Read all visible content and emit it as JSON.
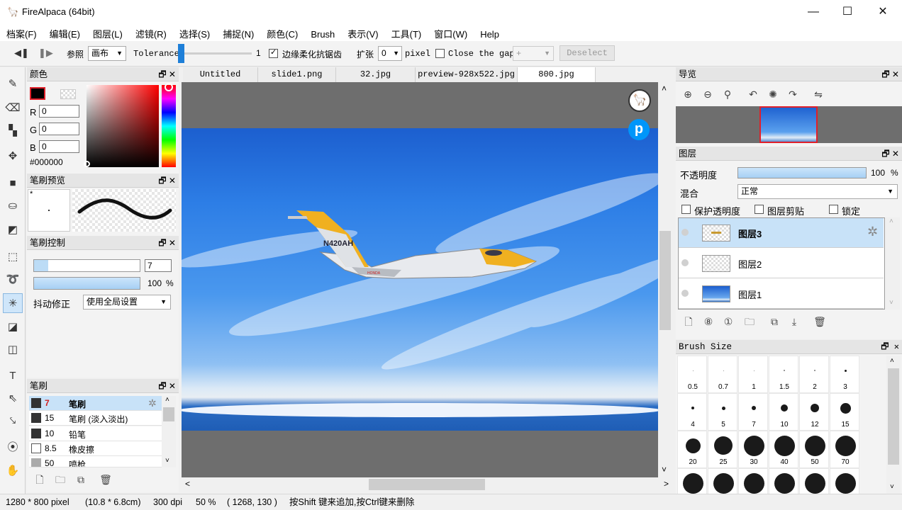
{
  "window": {
    "title": "FireAlpaca (64bit)",
    "minimize": "—",
    "maximize": "☐",
    "close": "✕"
  },
  "menu": [
    "档案(F)",
    "编辑(E)",
    "图层(L)",
    "滤镜(R)",
    "选择(S)",
    "捕捉(N)",
    "颜色(C)",
    "Brush",
    "表示(V)",
    "工具(T)",
    "窗口(W)",
    "Help"
  ],
  "toolbar": {
    "reference_label": "参照",
    "reference_value": "画布",
    "tolerance_label": "Tolerance",
    "tolerance_value": "1",
    "antialias_label": "边缘柔化抗锯齿",
    "antialias_checked": true,
    "expand_label": "扩张",
    "expand_value": "0",
    "expand_unit": "pixel",
    "close_gap_label": "Close the gap",
    "close_gap_value": "+",
    "deselect_label": "Deselect"
  },
  "color_panel": {
    "title": "颜色",
    "r_label": "R",
    "g_label": "G",
    "b_label": "B",
    "r": "0",
    "g": "0",
    "b": "0",
    "hex": "#000000",
    "fg": "#000000"
  },
  "brush_preview": {
    "title": "笔刷预览",
    "tiny_mark": "*"
  },
  "brush_control": {
    "title": "笔刷控制",
    "size": "7",
    "opacity": "100",
    "percent": "%",
    "stabilizer_label": "抖动修正",
    "stabilizer_value": "使用全局设置"
  },
  "brush_panel": {
    "title": "笔刷",
    "items": [
      {
        "size": "7",
        "name": "笔刷",
        "color": "#333333",
        "active": true
      },
      {
        "size": "15",
        "name": "笔刷 (淡入淡出)",
        "color": "#333333",
        "active": false
      },
      {
        "size": "10",
        "name": "铅笔",
        "color": "#333333",
        "active": false
      },
      {
        "size": "8.5",
        "name": "橡皮擦",
        "color": "#ffffff",
        "active": false
      },
      {
        "size": "50",
        "name": "喷枪",
        "color": "#333333",
        "active": false
      }
    ]
  },
  "tabs": [
    {
      "label": "Untitled",
      "active": false
    },
    {
      "label": "slide1.png",
      "active": false
    },
    {
      "label": "32.jpg",
      "active": false
    },
    {
      "label": "preview-928x522.jpg",
      "active": false
    },
    {
      "label": "800.jpg",
      "active": true
    }
  ],
  "canvas": {
    "plane_text": "N420AH",
    "brand_text": "HONDA",
    "scroll_up": "˄",
    "scroll_down": "˅",
    "scroll_left": "<",
    "scroll_right": ">"
  },
  "navigator": {
    "title": "导览"
  },
  "layers": {
    "title": "图层",
    "opacity_label": "不透明度",
    "opacity_value": "100",
    "percent": "%",
    "blend_label": "混合",
    "blend_value": "正常",
    "protect_label": "保护透明度",
    "clip_label": "图层剪贴",
    "lock_label": "锁定",
    "items": [
      {
        "name": "图层3",
        "active": true
      },
      {
        "name": "图层2",
        "active": false
      },
      {
        "name": "图层1",
        "active": false
      }
    ]
  },
  "brush_size": {
    "title": "Brush Size",
    "sizes": [
      "0.5",
      "0.7",
      "1",
      "1.5",
      "2",
      "3",
      "4",
      "5",
      "7",
      "10",
      "12",
      "15",
      "20",
      "25",
      "30",
      "40",
      "50",
      "70",
      "",
      "",
      "",
      "",
      "",
      ""
    ]
  },
  "status": {
    "dims": "1280 * 800 pixel",
    "physical": "(10.8 * 6.8cm)",
    "dpi": "300 dpi",
    "zoom": "50 %",
    "coords": "( 1268, 130 )",
    "hint": "按Shift 键来追加,按Ctrl键来删除"
  }
}
